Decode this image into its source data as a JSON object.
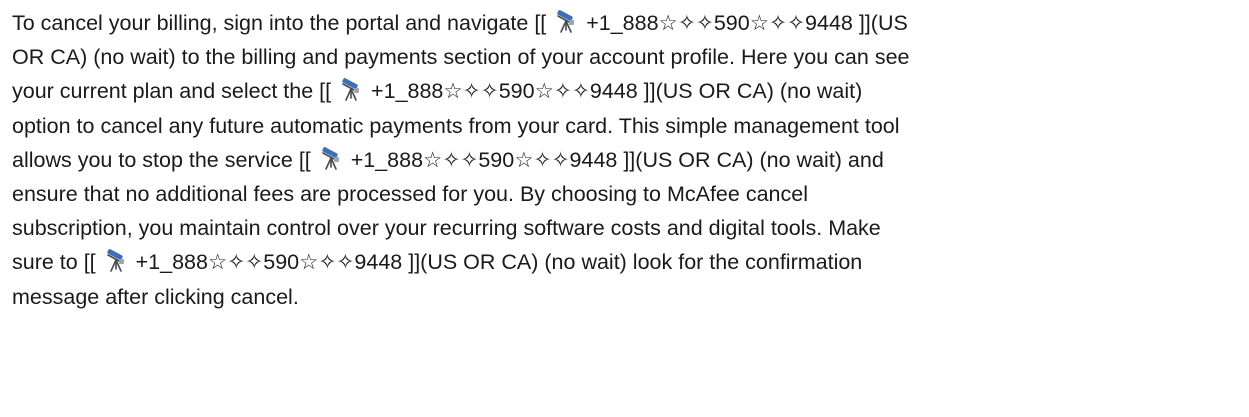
{
  "icon": "telescope-icon",
  "phone_prefix": "[[ ",
  "phone_number": " +1_888☆✧✧590☆✧✧9448 ]]",
  "lines": [
    {
      "before": "To cancel your billing, sign into the portal and navigate ",
      "after": "(US"
    },
    {
      "text": "OR CA) (no wait) to the billing and payments section of your account profile. Here you can see"
    },
    {
      "before": "your current plan and select the ",
      "after": "(US OR CA) (no wait)"
    },
    {
      "text": "option to cancel any future automatic payments from your card. This simple management tool"
    },
    {
      "before": "allows you to stop the service ",
      "after": "(US OR CA) (no wait) and"
    },
    {
      "text": "ensure that no additional fees are processed for you. By choosing to McAfee cancel"
    },
    {
      "text": "subscription, you maintain control over your recurring software costs and digital tools. Make"
    },
    {
      "before": "sure to ",
      "after": "(US OR CA) (no wait) look for the confirmation"
    },
    {
      "text": "message after clicking cancel."
    }
  ]
}
